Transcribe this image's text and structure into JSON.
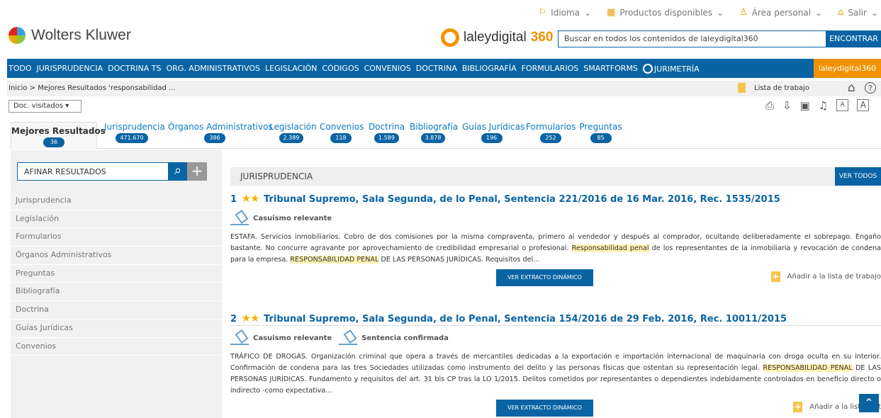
{
  "topbar": {
    "items": [
      {
        "label": "Idioma",
        "icon": "flag-icon"
      },
      {
        "label": "Productos disponibles",
        "icon": "grid-icon"
      },
      {
        "label": "Área personal",
        "icon": "user-icon"
      },
      {
        "label": "Salir",
        "icon": "lock-icon"
      }
    ]
  },
  "brand": {
    "name": "Wolters Kluwer",
    "product_prefix": "laleydigital",
    "product_suffix": "360"
  },
  "search": {
    "placeholder": "Buscar en todos los contenidos de laleydigital360",
    "button": "ENCONTRAR"
  },
  "nav": {
    "items": [
      "TODO",
      "JURISPRUDENCIA",
      "DOCTRINA TS",
      "ORG. ADMINISTRATIVOS",
      "LEGISLACIÓN",
      "CÓDIGOS",
      "CONVENIOS",
      "DOCTRINA",
      "BIBLIOGRAFÍA",
      "FORMULARIOS",
      "SMARTFORMS",
      "JURIMETRÍA"
    ],
    "right": "laleydigital360"
  },
  "breadcrumb": "Inicio > Mejores Resultados 'responsabilidad ...",
  "worklist": "Lista de trabajo",
  "doc_select": "Doc. visitados",
  "tabs": [
    {
      "label": "Mejores Resultados",
      "count": "36"
    },
    {
      "label": "Jurisprudencia",
      "count": "471.670"
    },
    {
      "label": "Órganos Administrativos",
      "count": "386"
    },
    {
      "label": "Legislación",
      "count": "2.389"
    },
    {
      "label": "Convenios",
      "count": "118"
    },
    {
      "label": "Doctrina",
      "count": "1.589"
    },
    {
      "label": "Bibliografía",
      "count": "3.878"
    },
    {
      "label": "Guías Jurídicas",
      "count": "196"
    },
    {
      "label": "Formularios",
      "count": "252"
    },
    {
      "label": "Preguntas",
      "count": "85"
    }
  ],
  "sidebar": {
    "refine": "AFINAR RESULTADOS",
    "items": [
      "Jurisprudencia",
      "Legislación",
      "Formularios",
      "Órganos Administrativos",
      "Preguntas",
      "Bibliografía",
      "Doctrina",
      "Guías Jurídicas",
      "Convenios"
    ]
  },
  "section": {
    "title": "JURISPRUDENCIA",
    "view_all": "VER TODOS"
  },
  "results": [
    {
      "index": "1",
      "title": "Tribunal Supremo, Sala Segunda, de lo Penal, Sentencia 221/2016 de 16 Mar. 2016, Rec. 1535/2015",
      "tags": [
        "Casuismo relevante"
      ],
      "text_1": "ESTAFA. Servicios inmobiliarios. Cobro de dos comisiones por la misma compraventa, primero al vendedor y después al comprador, ocultando deliberadamente el sobrepago. Engaño bastante. No concurre agravante por aprovechamiento de credibilidad empresarial o profesional. ",
      "highlight_1": "Responsabilidad penal",
      "text_2": " de los representantes de la inmobiliaria y revocación de condena para la empresa. ",
      "highlight_2": "RESPONSABILIDAD PENAL",
      "text_3": " DE LAS PERSONAS JURÍDICAS. Requisitos del...",
      "button": "VER EXTRACTO DINÁMICO",
      "add": "Añadir a la lista de trabajo"
    },
    {
      "index": "2",
      "title": "Tribunal Supremo, Sala Segunda, de lo Penal, Sentencia 154/2016 de 29 Feb. 2016, Rec. 10011/2015",
      "tags": [
        "Casuismo relevante",
        "Sentencia confirmada"
      ],
      "text_1": "TRÁFICO DE DROGAS. Organización criminal que opera a través de mercantiles dedicadas a la exportación e importación internacional de maquinaria con droga oculta en su interior. Confirmación de condena para las tres Sociedades utilizadas como instrumento del delito y las personas físicas que ostentan su representación legal. ",
      "highlight_1": "RESPONSABILIDAD PENAL",
      "text_2": " DE LAS PERSONAS JURÍDICAS. Fundamento y requisitos del art. 31 bis CP tras la LO 1/2015. Delitos cometidos por representantes o dependientes indebidamente controlados en beneficio directo o indirecto -como expectativa...",
      "button": "VER EXTRACTO DINÁMICO",
      "add": "Añadir a la lista de t"
    }
  ],
  "colors": {
    "primary": "#0a64a4",
    "orange": "#f29200",
    "highlight": "#fff3b3"
  }
}
